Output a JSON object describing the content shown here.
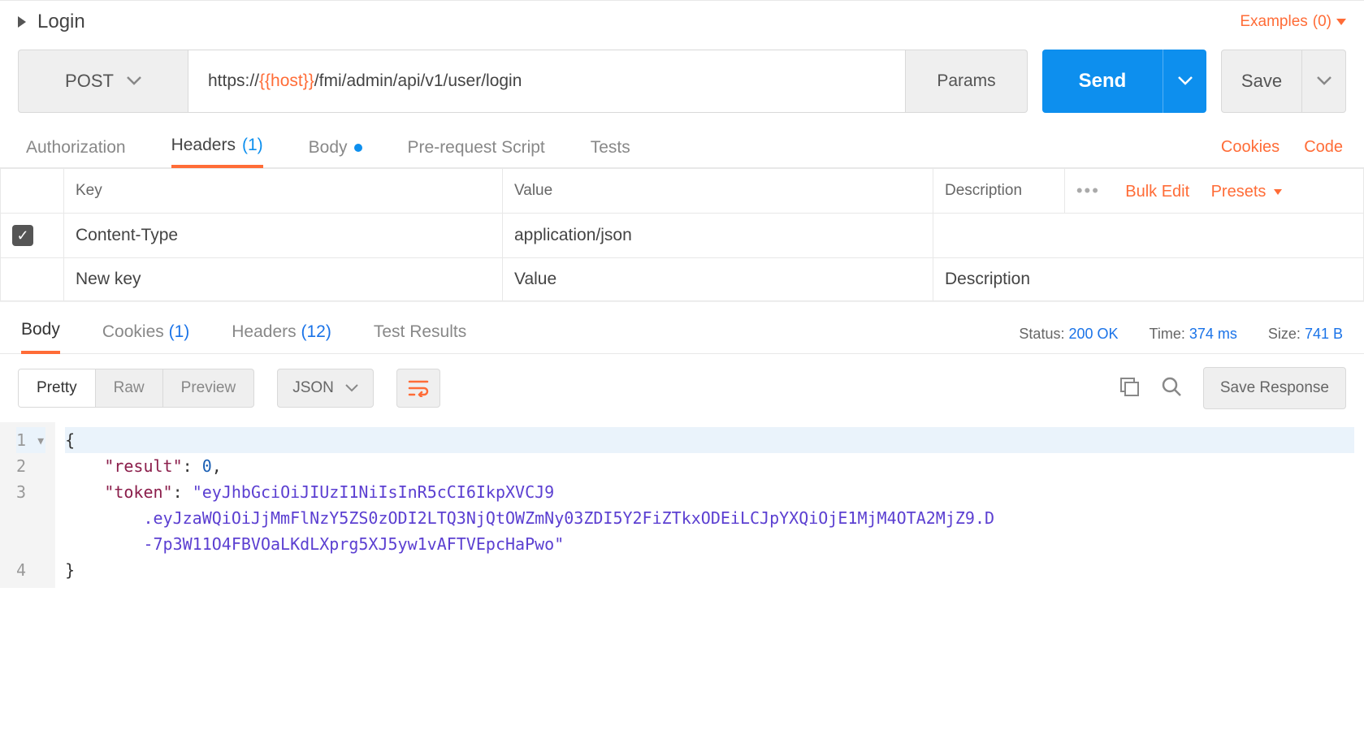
{
  "title": "Login",
  "examples": {
    "label": "Examples",
    "count": "(0)"
  },
  "request": {
    "method": "POST",
    "url_prefix": "https://",
    "url_variable": "{{host}}",
    "url_suffix": "/fmi/admin/api/v1/user/login",
    "params_label": "Params",
    "send_label": "Send",
    "save_label": "Save"
  },
  "req_tabs": {
    "authorization": "Authorization",
    "headers": "Headers",
    "headers_count": "(1)",
    "body": "Body",
    "prerequest": "Pre-request Script",
    "tests": "Tests"
  },
  "req_actions": {
    "cookies": "Cookies",
    "code": "Code"
  },
  "headers_table": {
    "th_key": "Key",
    "th_value": "Value",
    "th_description": "Description",
    "bulk_edit": "Bulk Edit",
    "presets": "Presets",
    "rows": [
      {
        "enabled": true,
        "key": "Content-Type",
        "value": "application/json",
        "description": ""
      }
    ],
    "new_key_placeholder": "New key",
    "new_value_placeholder": "Value",
    "new_description_placeholder": "Description"
  },
  "resp_tabs": {
    "body": "Body",
    "cookies": "Cookies",
    "cookies_count": "(1)",
    "headers": "Headers",
    "headers_count": "(12)",
    "test_results": "Test Results"
  },
  "status": {
    "label": "Status:",
    "value": "200 OK"
  },
  "time": {
    "label": "Time:",
    "value": "374 ms"
  },
  "size": {
    "label": "Size:",
    "value": "741 B"
  },
  "view_modes": {
    "pretty": "Pretty",
    "raw": "Raw",
    "preview": "Preview"
  },
  "format_select": "JSON",
  "save_response": "Save Response",
  "response_body": {
    "result_key": "\"result\"",
    "result_value": "0",
    "token_key": "\"token\"",
    "token_line1": "\"eyJhbGciOiJIUzI1NiIsInR5cCI6IkpXVCJ9",
    "token_line2": ".eyJzaWQiOiJjMmFlNzY5ZS0zODI2LTQ3NjQtOWZmNy03ZDI5Y2FiZTkxODEiLCJpYXQiOjE1MjM4OTA2MjZ9.D",
    "token_line3": "-7p3W11O4FBVOaLKdLXprg5XJ5yw1vAFTVEpcHaPwo\""
  }
}
